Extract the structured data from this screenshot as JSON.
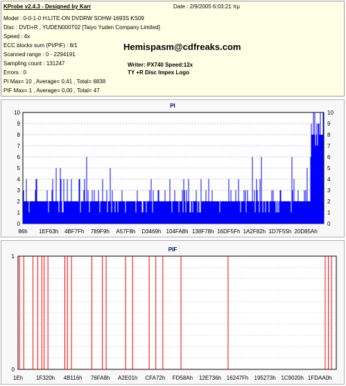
{
  "header": {
    "title": "KProbe v2.4.3 - Designed by Karr",
    "date": "Date : 2/9/2005 6:03:21 πμ",
    "lines": [
      "Model : 0-0-1-0 H:LITE-ON DVDRW SOHW-1693S KS09",
      "Disc : DVD+R , YUDEN000T02 [Taiyo Yuden Company Limited]",
      "Speed : 4x",
      "ECC blocks sum (PI/PIF) : 8/1",
      "Scanned range : 0 - 2294191",
      "Sampling count : 131247",
      "Errors : 0",
      "PI Max= 10 , Average= 0,41 , Total= 6838",
      "PIF Max= 1 , Average= 0,00 , Total= 47"
    ],
    "email": "Hemispasm@cdfreaks.com",
    "writer": "Writer: PX740 Speed:12x",
    "media_note": "TY +R Disc Impex Logo"
  },
  "chart_data": [
    {
      "type": "bar",
      "title": "PI",
      "ylim": [
        0,
        10
      ],
      "yticks": [
        "0",
        "1",
        "2",
        "3",
        "4",
        "5",
        "6",
        "7",
        "8",
        "9",
        "10"
      ],
      "xticks": [
        "86h",
        "1EF63h",
        "4BF7Fh",
        "789F9h",
        "A57F8h",
        "D3469h",
        "104FA8h",
        "138F78h",
        "16DF5Fh",
        "1A2F82h",
        "1D7F55h",
        "20D85Ah"
      ],
      "grid": true,
      "color": "#0000ff"
    },
    {
      "type": "bar",
      "title": "PIF",
      "ylim": [
        0,
        1
      ],
      "yticks": [
        "0",
        "1"
      ],
      "xticks": [
        "1Eh",
        "1F320h",
        "4B116h",
        "76FA8h",
        "A2E01h",
        "CFA72h",
        "FD58Ah",
        "12E736h",
        "16247Fh",
        "195273h",
        "1C9020h",
        "1FDAA0h"
      ],
      "grid": true,
      "color": "#ff0000",
      "spike_positions": [
        0.005,
        0.018,
        0.047,
        0.062,
        0.075,
        0.082,
        0.094,
        0.147,
        0.155,
        0.168,
        0.232,
        0.265,
        0.277,
        0.338,
        0.36,
        0.412,
        0.433,
        0.455,
        0.512,
        0.66,
        0.965,
        0.975,
        0.985
      ]
    }
  ]
}
